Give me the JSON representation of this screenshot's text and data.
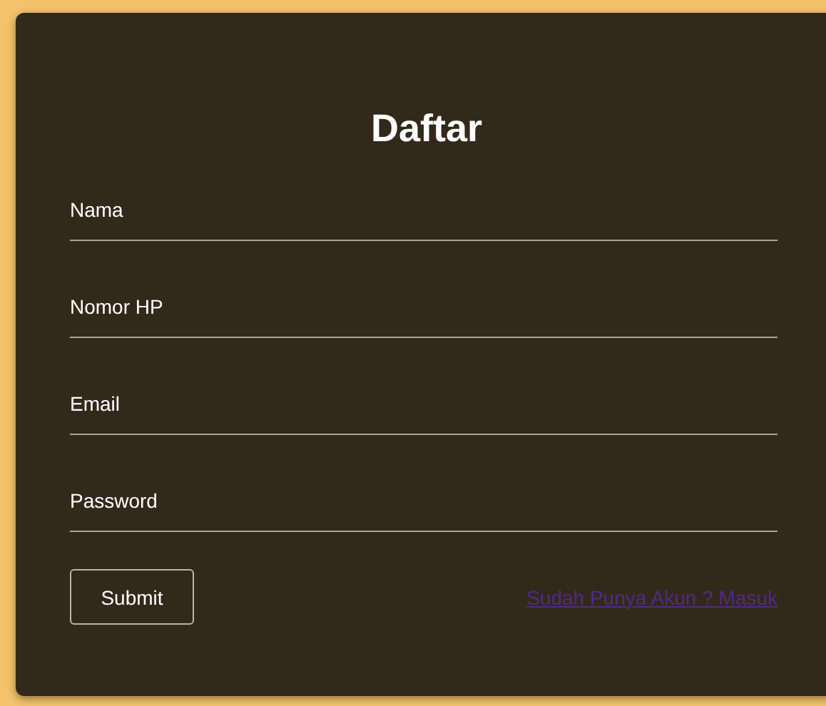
{
  "title": "Daftar",
  "fields": [
    {
      "placeholder": "Nama"
    },
    {
      "placeholder": "Nomor HP"
    },
    {
      "placeholder": "Email"
    },
    {
      "placeholder": "Password"
    }
  ],
  "submit": "Submit",
  "link": "Sudah Punya Akun ? Masuk"
}
